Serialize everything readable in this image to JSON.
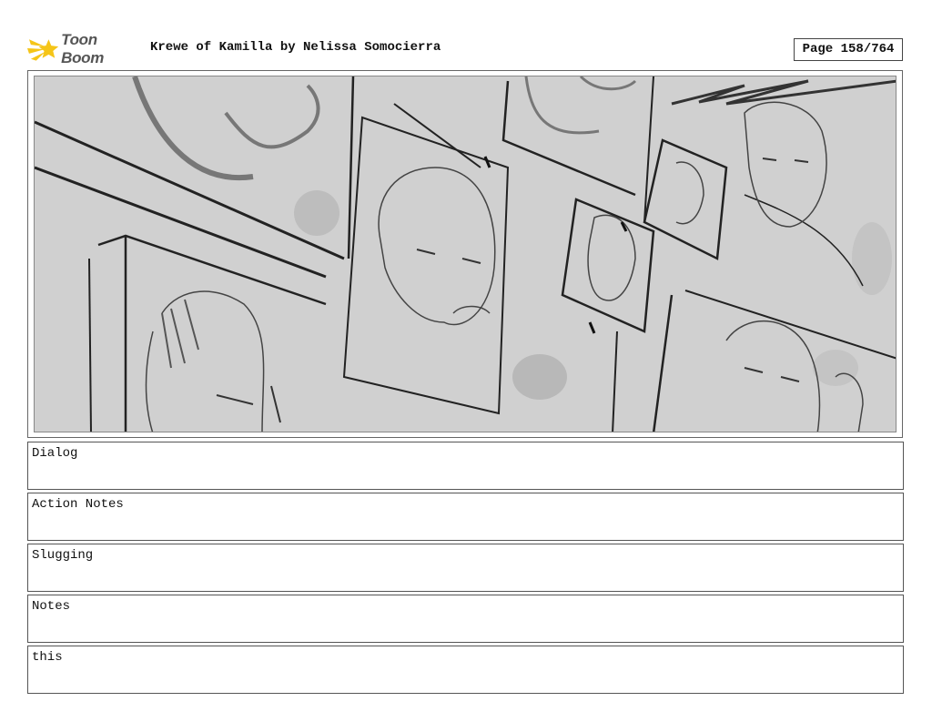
{
  "header": {
    "logo_text": "Toon Boom",
    "title": "Krewe of Kamilla by Nelissa Somocierra",
    "page_label": "Page 158/764"
  },
  "panel": {
    "icon": "storyboard-sketch"
  },
  "fields": {
    "dialog": "Dialog",
    "action_notes": "Action Notes",
    "slugging": "Slugging",
    "notes": "Notes",
    "this": "this"
  },
  "colors": {
    "logo_accent": "#f5c518",
    "panel_bg": "#d0d0d0",
    "sketch_line": "#222222"
  }
}
